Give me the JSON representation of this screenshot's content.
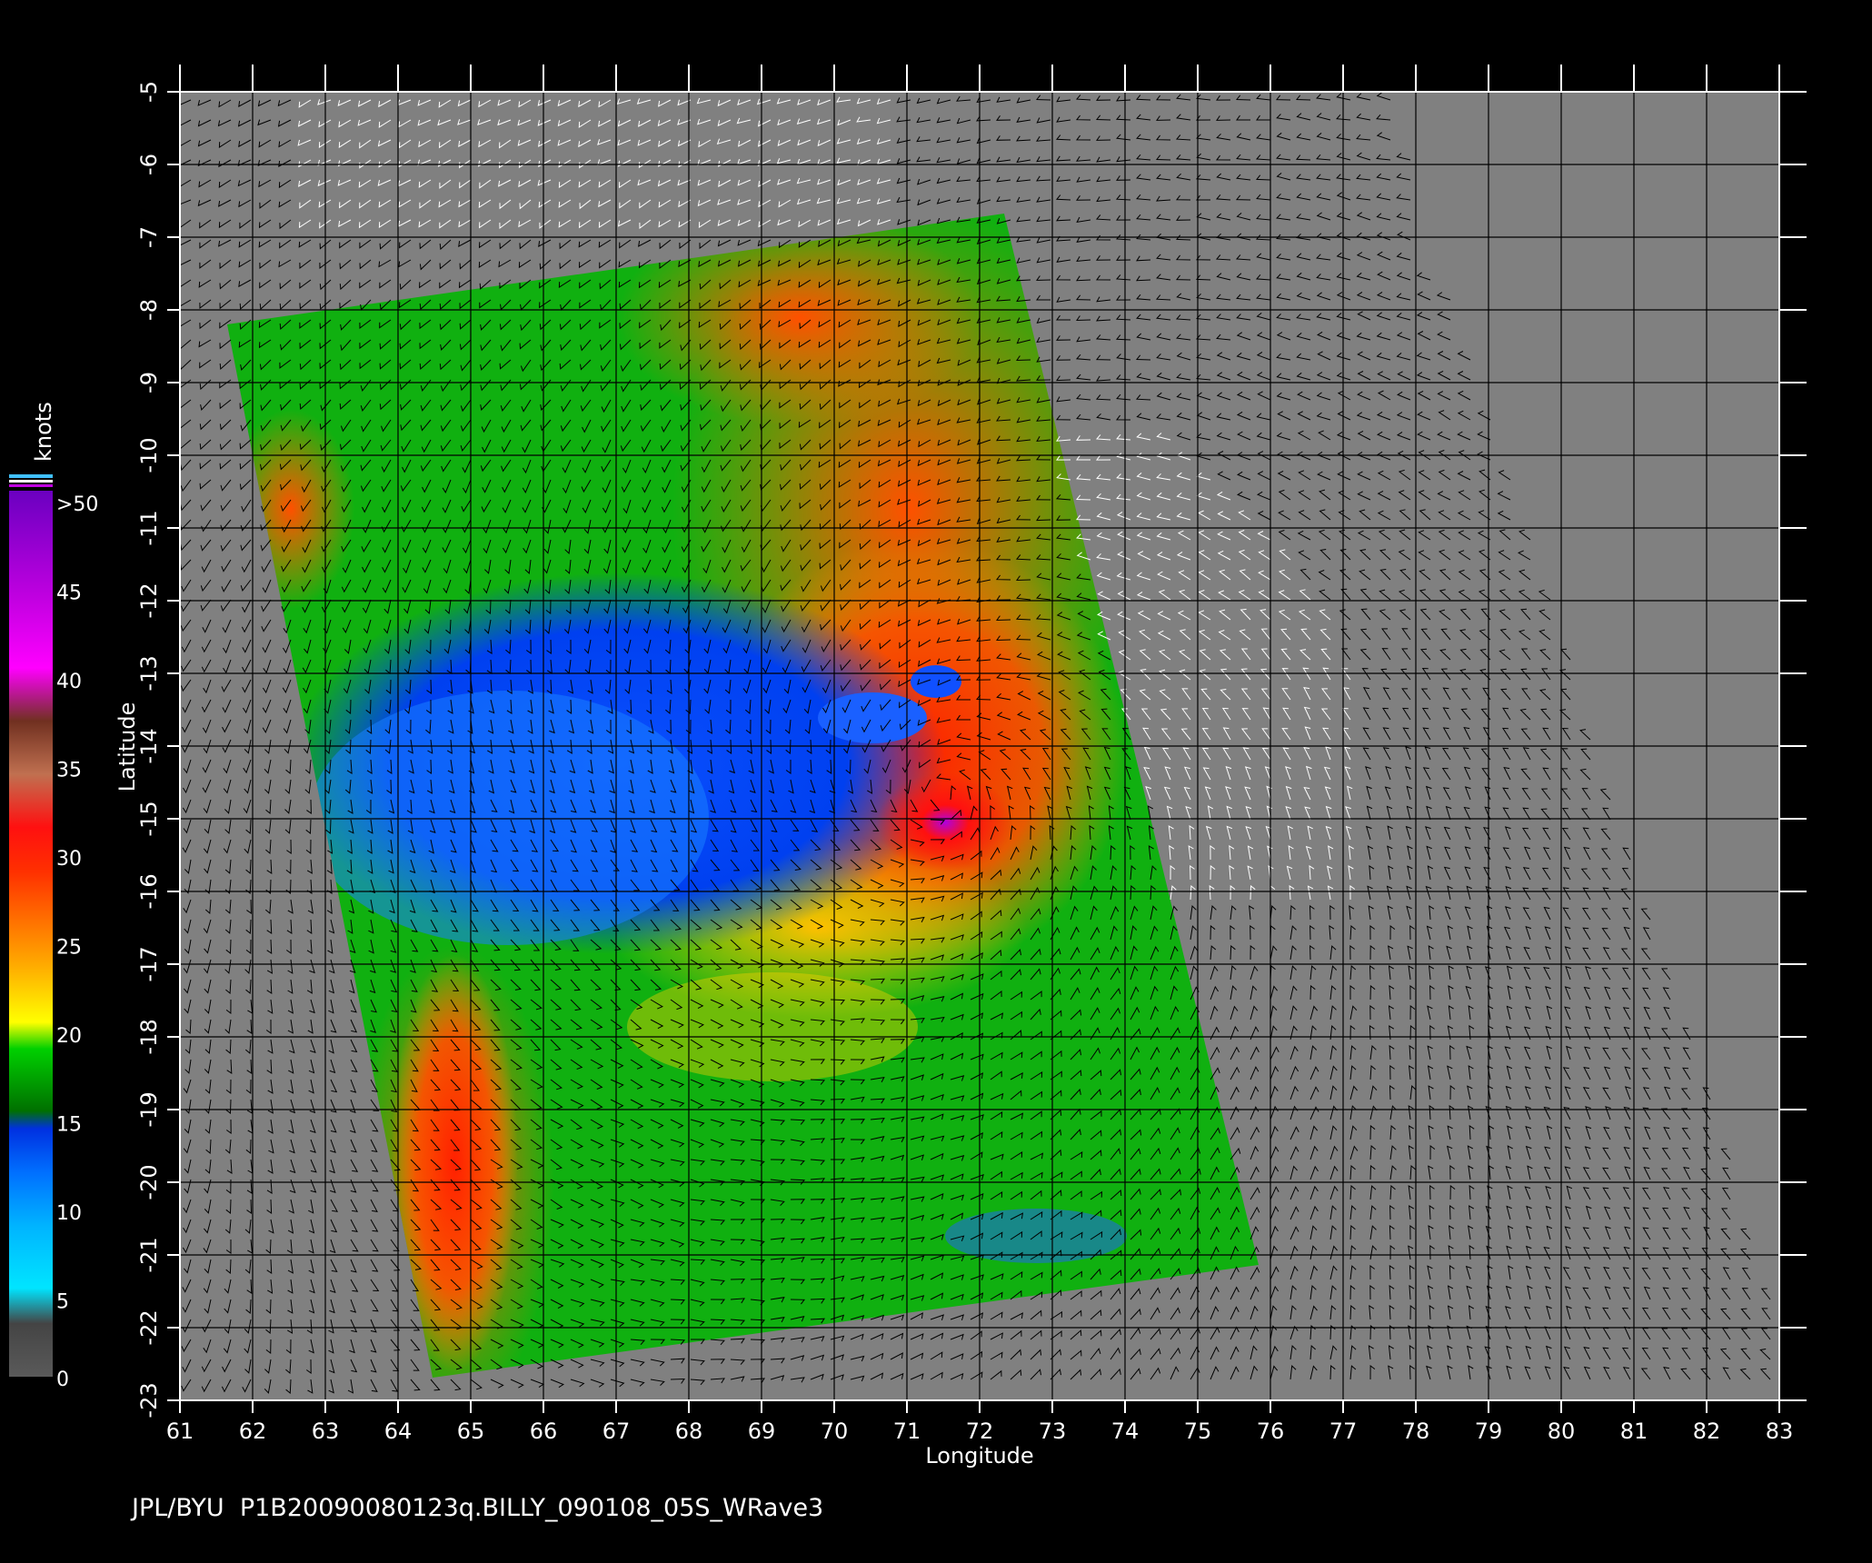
{
  "map": {
    "x_axis_label": "Longitude",
    "y_axis_label": "Latitude",
    "lon_ticks": [
      "61",
      "62",
      "63",
      "64",
      "65",
      "66",
      "67",
      "68",
      "69",
      "70",
      "71",
      "72",
      "73",
      "74",
      "75",
      "76",
      "77",
      "78",
      "79",
      "80",
      "81",
      "82",
      "83"
    ],
    "lat_ticks": [
      "-5",
      "-6",
      "-7",
      "-8",
      "-9",
      "-10",
      "-11",
      "-12",
      "-13",
      "-14",
      "-15",
      "-16",
      "-17",
      "-18",
      "-19",
      "-20",
      "-21",
      "-22",
      "-23"
    ],
    "lon_range": [
      61,
      83
    ],
    "lat_range": [
      -5,
      -23
    ],
    "background_color": "#808080",
    "storm_center": {
      "lon": 71.5,
      "lat": -14.7
    }
  },
  "colorbar": {
    "unit_label": "knots",
    "tick_labels": [
      "0",
      "5",
      "10",
      "15",
      "20",
      "25",
      "30",
      "35",
      "40",
      "45",
      ">50"
    ],
    "ticks": [
      0,
      5,
      10,
      15,
      20,
      25,
      30,
      35,
      40,
      45,
      50
    ]
  },
  "footer": {
    "credit": "JPL/BYU  P1B20090080123q.BILLY_090108_05S_WRave3"
  }
}
